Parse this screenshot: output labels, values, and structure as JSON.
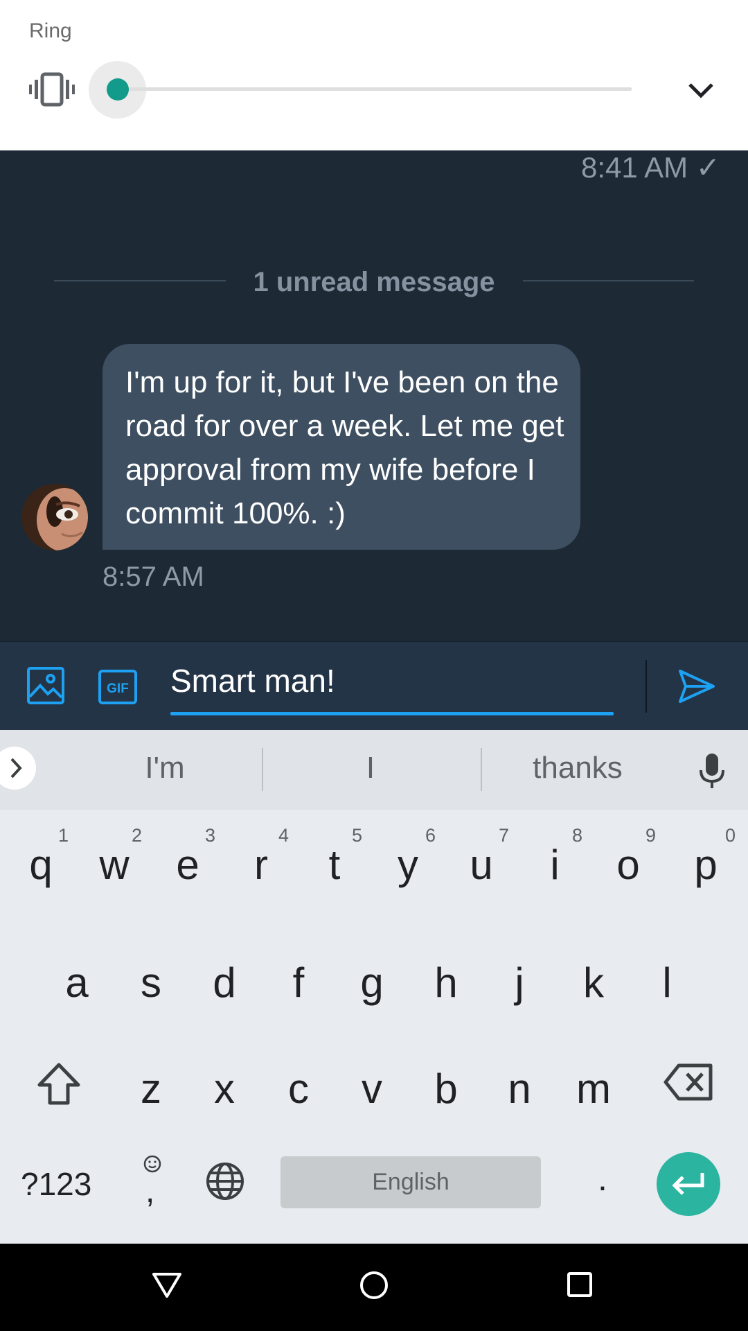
{
  "volume_panel": {
    "title": "Ring",
    "level": 0,
    "icons": {
      "mode": "vibrate-icon",
      "expand": "chevron-down-icon"
    },
    "accent_color": "#129b8a"
  },
  "chat": {
    "previous_message_time": "8:41 AM ✓",
    "unread_divider": "1 unread message",
    "message": {
      "text": "I'm up for it, but I've been on the road for over a week. Let me get approval from my wife before I commit 100%. :)",
      "time": "8:57 AM"
    }
  },
  "composer": {
    "input_value": "Smart man!",
    "icons": {
      "image": "image-icon",
      "gif": "GIF",
      "send": "send-icon"
    },
    "accent_color": "#1da1f2"
  },
  "keyboard": {
    "suggestions": [
      "I'm",
      "I",
      "thanks"
    ],
    "rows": [
      [
        {
          "k": "q",
          "n": "1"
        },
        {
          "k": "w",
          "n": "2"
        },
        {
          "k": "e",
          "n": "3"
        },
        {
          "k": "r",
          "n": "4"
        },
        {
          "k": "t",
          "n": "5"
        },
        {
          "k": "y",
          "n": "6"
        },
        {
          "k": "u",
          "n": "7"
        },
        {
          "k": "i",
          "n": "8"
        },
        {
          "k": "o",
          "n": "9"
        },
        {
          "k": "p",
          "n": "0"
        }
      ],
      [
        "a",
        "s",
        "d",
        "f",
        "g",
        "h",
        "j",
        "k",
        "l"
      ],
      [
        "z",
        "x",
        "c",
        "v",
        "b",
        "n",
        "m"
      ]
    ],
    "symbols_label": "?123",
    "comma_label": ",",
    "space_label": "English",
    "period_label": ".",
    "enter_color": "#2bb4a0"
  }
}
